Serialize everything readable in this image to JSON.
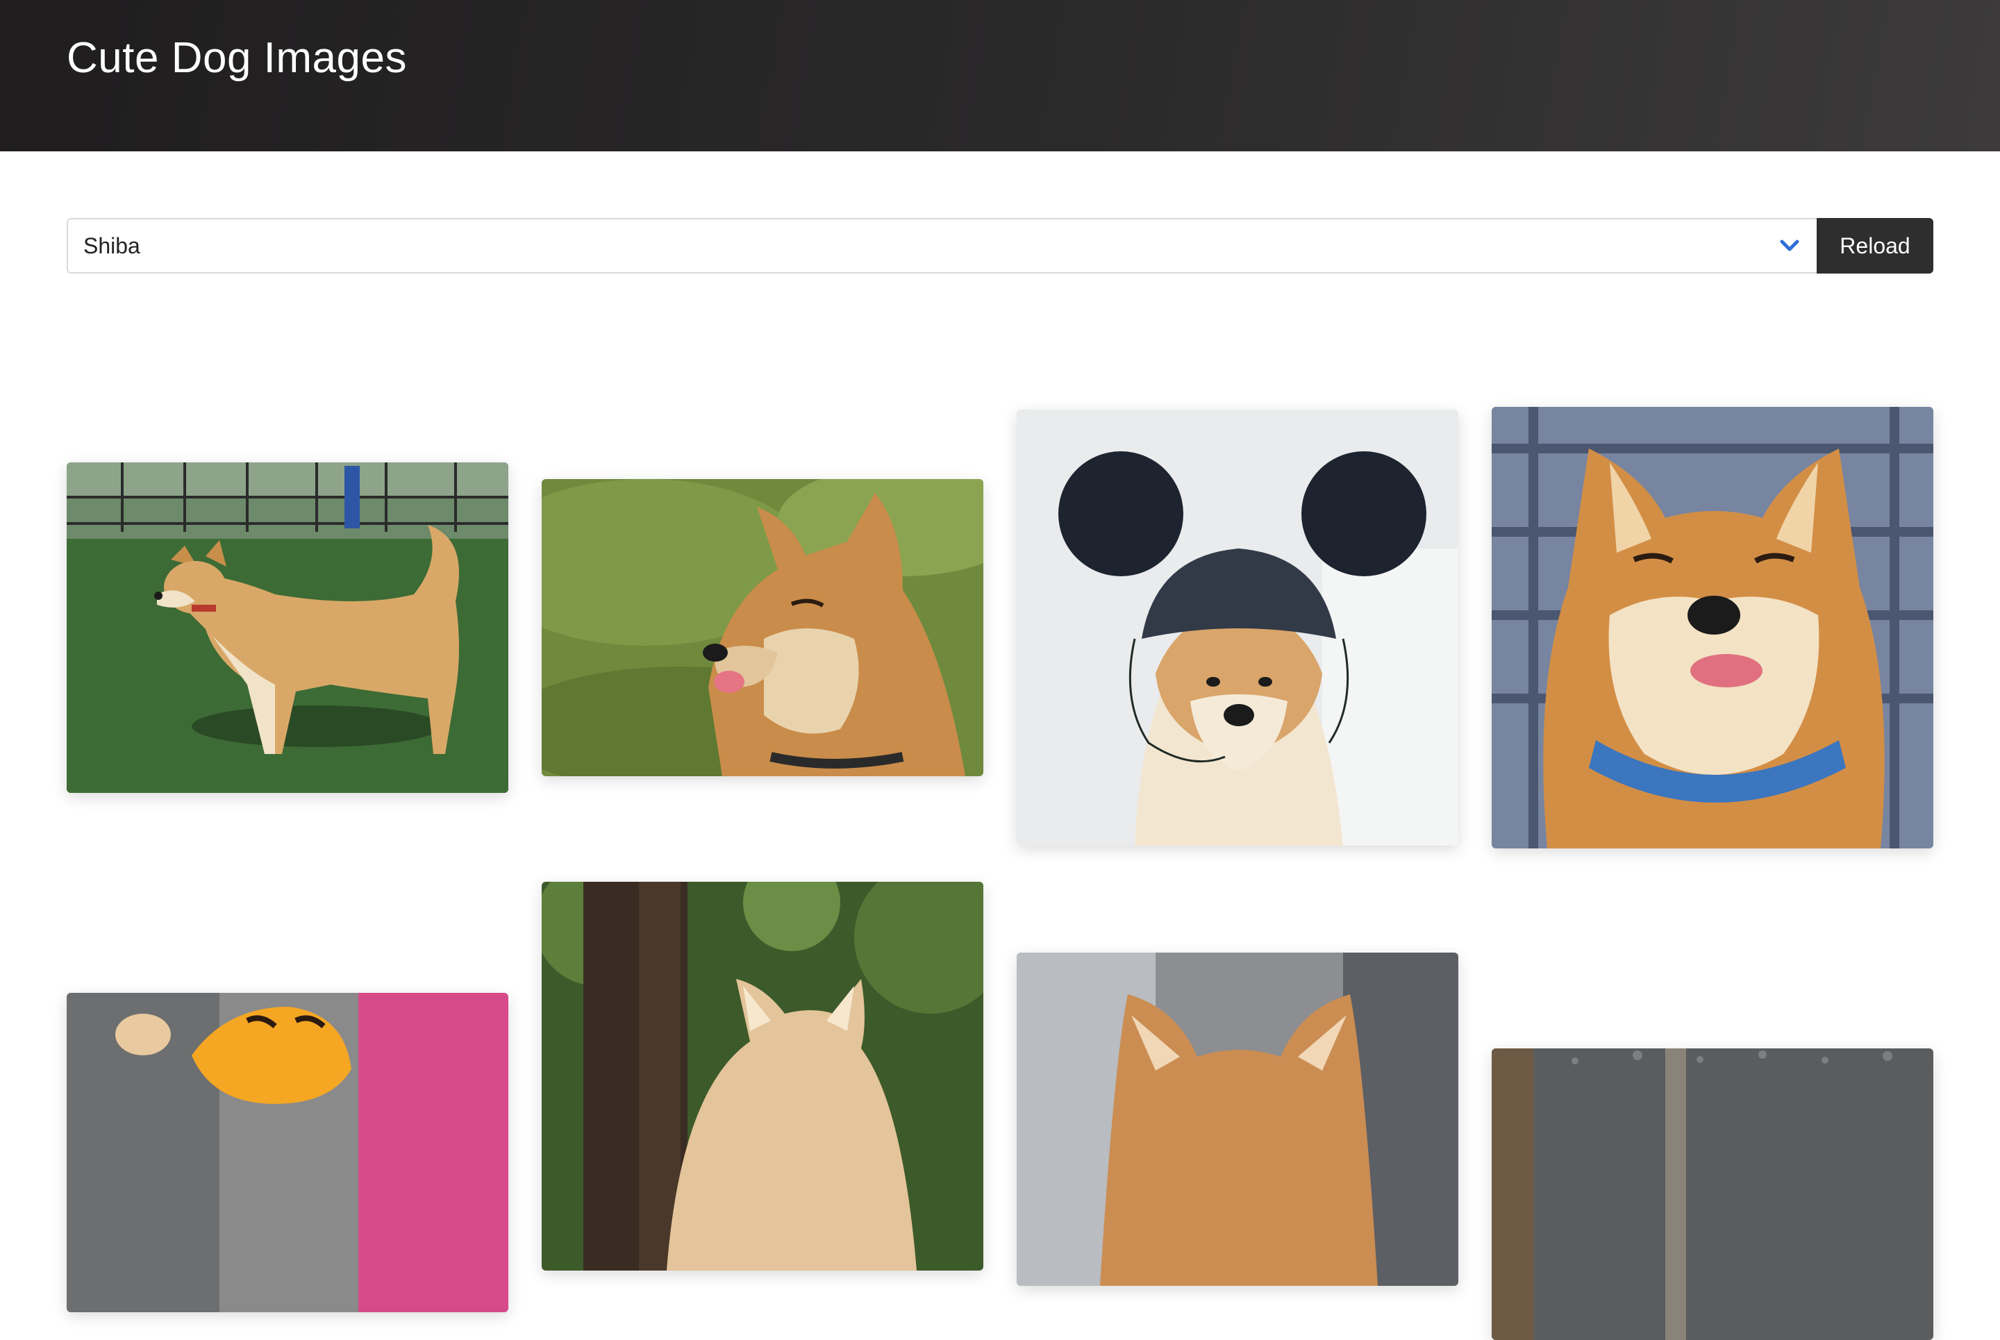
{
  "header": {
    "title": "Cute Dog Images"
  },
  "controls": {
    "selected_breed": "Shiba",
    "reload_label": "Reload"
  },
  "colors": {
    "header_dark": "#1f1d1e",
    "accent_chevron": "#2f6fd6",
    "button_dark": "#2e2e2f"
  },
  "images": [
    {
      "name": "shiba-standing-on-grass-photo"
    },
    {
      "name": "shiba-licking-lips-photo"
    },
    {
      "name": "shiba-wearing-mouse-ear-hat-photo"
    },
    {
      "name": "shiba-blue-collar-tongue-photo"
    },
    {
      "name": "shiba-with-pumpkin-photo"
    },
    {
      "name": "shiba-in-forest-photo"
    },
    {
      "name": "shiba-ears-closeup-photo"
    },
    {
      "name": "shiba-gravel-photo"
    }
  ]
}
